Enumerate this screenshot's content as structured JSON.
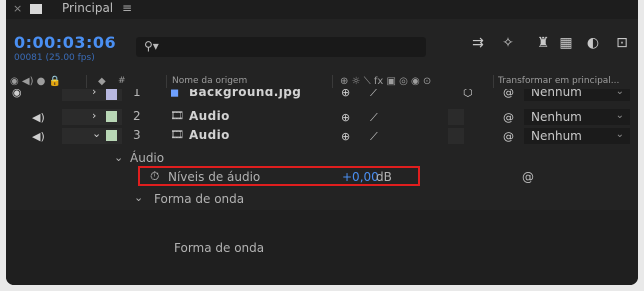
{
  "tab": {
    "label": "Principal",
    "close_glyph": "×",
    "menu_glyph": "≡"
  },
  "time": {
    "timecode": "0:00:03:06",
    "frames": "00081 (25.00 fps)"
  },
  "search": {
    "placeholder": "",
    "icon": "search-icon"
  },
  "columns": {
    "av_icons": "◉ ◀) ● 🔒",
    "label_icon": "◆",
    "number": "#",
    "source_name": "Nome da origem",
    "switches": "⊕ ☼ ⟍ fx ▣ ◎ ◉ ⊙",
    "parent": "Transformar em principal..."
  },
  "layers": [
    {
      "number": "1",
      "name": "Background.jpg",
      "swatch_color": "#b8b8e0",
      "parent": "Nenhum"
    },
    {
      "number": "2",
      "name": "Audio",
      "swatch_color": "#b9d7b6",
      "parent": "Nenhum"
    },
    {
      "number": "3",
      "name": "Audio",
      "swatch_color": "#b9d7b6",
      "parent": "Nenhum"
    }
  ],
  "audio_group": {
    "label": "Áudio",
    "levels_label": "Níveis de áudio",
    "levels_value": "+0,00",
    "levels_unit": "dB",
    "waveform_label": "Forma de onda",
    "waveform_sub_label": "Forma de onda"
  },
  "colors": {
    "accent": "#4a8ff2",
    "highlight": "#e01e1e"
  }
}
